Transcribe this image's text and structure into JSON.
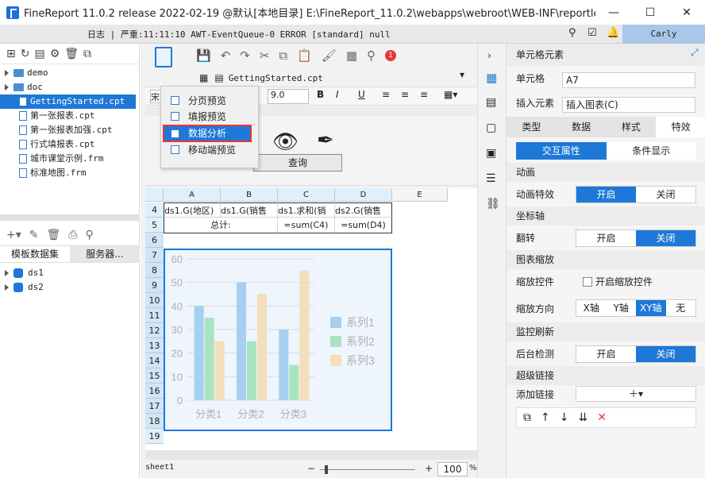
{
  "window": {
    "title": "FineReport 11.0.2 release 2022-02-19 @默认[本地目录]    E:\\FineReport_11.0.2\\webapps\\webroot\\WEB-INF\\reportlets/Getti..."
  },
  "status": {
    "log_label": "日志",
    "log_text": "严重:11:11:10 AWT-EventQueue-0 ERROR [standard] null",
    "user": "Carly"
  },
  "tree": {
    "items": [
      {
        "label": "demo",
        "type": "folder"
      },
      {
        "label": "doc",
        "type": "folder"
      },
      {
        "label": "GettingStarted.cpt",
        "type": "file",
        "selected": true
      },
      {
        "label": "第一张报表.cpt",
        "type": "file"
      },
      {
        "label": "第一张报表加强.cpt",
        "type": "file"
      },
      {
        "label": "行式填报表.cpt",
        "type": "file"
      },
      {
        "label": "城市课堂示例.frm",
        "type": "file"
      },
      {
        "label": "标准地图.frm",
        "type": "file"
      }
    ]
  },
  "datasets": {
    "tab1": "模板数据集",
    "tab2": "服务器...",
    "items": [
      "ds1",
      "ds2"
    ]
  },
  "editor": {
    "doc_tab": "GettingStarted.cpt",
    "font_name": "宋",
    "font_size": "9.0",
    "query_button": "查询",
    "zoom": "100",
    "zoom_unit": "%",
    "sheet_tab": "sheet1",
    "notif_count": "1"
  },
  "menu": {
    "items": [
      "分页预览",
      "填报预览",
      "数据分析",
      "移动端预览"
    ],
    "selected": 2
  },
  "grid": {
    "columns": [
      "A",
      "B",
      "C",
      "D",
      "E"
    ],
    "rows": [
      "4",
      "5",
      "6",
      "7",
      "8",
      "9",
      "10",
      "11",
      "12",
      "13",
      "14",
      "15",
      "16",
      "17",
      "18",
      "19"
    ],
    "r4": [
      "ds1.G(地区)",
      "ds1.G(销售",
      "ds1.求和(销",
      "ds2.G(销售"
    ],
    "r5": [
      "总计:",
      "=sum(C4)",
      "=sum(D4)"
    ]
  },
  "chart_data": {
    "type": "bar",
    "categories": [
      "分类1",
      "分类2",
      "分类3"
    ],
    "series": [
      {
        "name": "系列1",
        "values": [
          40,
          50,
          30
        ],
        "color": "#a6cff2"
      },
      {
        "name": "系列2",
        "values": [
          35,
          25,
          15
        ],
        "color": "#a9e4c2"
      },
      {
        "name": "系列3",
        "values": [
          25,
          45,
          55
        ],
        "color": "#f3dfb9"
      }
    ],
    "yticks": [
      "0",
      "10",
      "20",
      "30",
      "40",
      "50",
      "60"
    ],
    "ylim": [
      0,
      60
    ],
    "legend": "right"
  },
  "props": {
    "title": "单元格元素",
    "cell_label": "单元格",
    "cell_value": "A7",
    "insert_label": "插入元素",
    "insert_value": "插入图表(C)",
    "tabs": [
      "类型",
      "数据",
      "样式",
      "特效"
    ],
    "subtabs": [
      "交互属性",
      "条件显示"
    ],
    "sections": {
      "anim": "动画",
      "anim_effect": "动画特效",
      "axis": "坐标轴",
      "flip": "翻转",
      "zoom": "图表缩放",
      "zoom_ctrl": "缩放控件",
      "zoom_ctrl_check": "开启缩放控件",
      "zoom_dir": "缩放方向",
      "monitor": "监控刷新",
      "bg_check": "后台检测",
      "hyperlink": "超级链接",
      "add_link": "添加链接"
    },
    "on": "开启",
    "off": "关闭",
    "dir_options": [
      "X轴",
      "Y轴",
      "XY轴",
      "无"
    ]
  },
  "colors": {
    "accent": "#1e78d7",
    "header": "#dff0fb"
  }
}
